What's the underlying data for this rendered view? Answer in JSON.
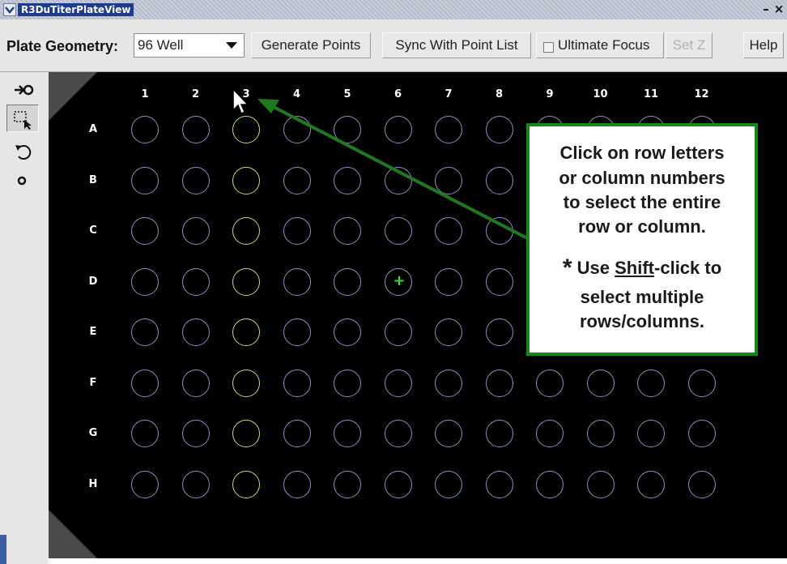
{
  "window": {
    "title": "R3DuTiterPlateView",
    "minimize_label": "–",
    "close_label": "×"
  },
  "toolbar": {
    "geometry_label": "Plate Geometry:",
    "geometry_value": "96 Well",
    "generate_label": "Generate Points",
    "sync_label": "Sync With Point List",
    "focus_label": "Ultimate Focus",
    "focus_checked": false,
    "setz_label": "Set Z",
    "setz_enabled": false,
    "help_label": "Help"
  },
  "tools": [
    {
      "name": "add-point-tool",
      "icon": "arrow-circle-icon",
      "active": false
    },
    {
      "name": "select-tool",
      "icon": "marquee-select-icon",
      "active": true
    },
    {
      "name": "undo-tool",
      "icon": "undo-icon",
      "active": false
    },
    {
      "name": "point-tool",
      "icon": "circle-icon",
      "active": false
    }
  ],
  "plate": {
    "columns": [
      "1",
      "2",
      "3",
      "4",
      "5",
      "6",
      "7",
      "8",
      "9",
      "10",
      "11",
      "12"
    ],
    "rows": [
      "A",
      "B",
      "C",
      "D",
      "E",
      "F",
      "G",
      "H"
    ],
    "selected_column": "3",
    "marked_well": "D6",
    "marker_glyph": "+",
    "colors": {
      "background": "#000000",
      "well": "#8f8fc4",
      "selected_well": "#d6d478",
      "marker": "#35e035"
    }
  },
  "callout": {
    "line1": "Click on row letters",
    "line2": "or column numbers",
    "line3": "to select the entire",
    "line4": "row or column.",
    "star": "*",
    "line5_pre": "Use ",
    "line5_key": "Shift",
    "line5_post": "-click to",
    "line6": "select multiple",
    "line7": "rows/columns.",
    "border_color": "#17861a",
    "arrow_color": "#1e7a1e"
  }
}
